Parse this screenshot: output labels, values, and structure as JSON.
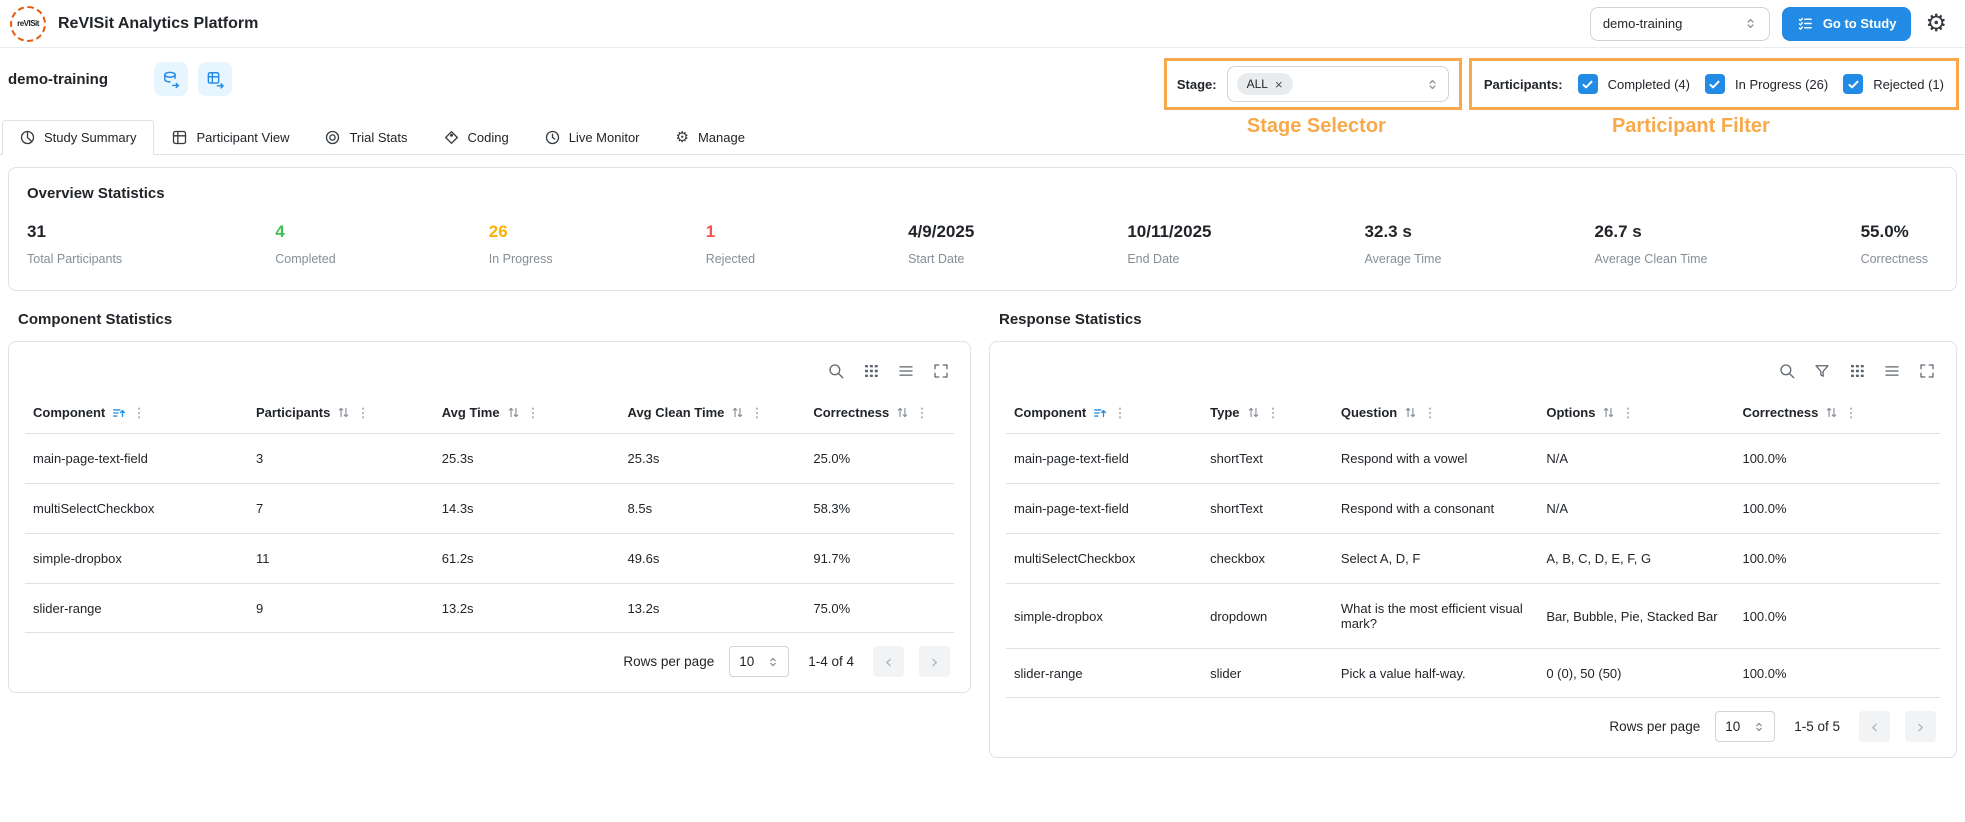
{
  "colors": {
    "accent_blue": "#228be6",
    "completed_green": "#40c057",
    "in_progress_orange": "#fab005",
    "rejected_red": "#fa5252",
    "annotation_orange": "#f7a94b",
    "logo_orange": "#e8590c"
  },
  "icons": {
    "gear": "⚙",
    "close": "×",
    "chevron_left": "‹",
    "chevron_right": "›"
  },
  "header": {
    "logo_text": "reVISit",
    "app_title": "ReVISit Analytics Platform",
    "study_select_value": "demo-training",
    "go_to_study_label": "Go to Study"
  },
  "subheader": {
    "study_name": "demo-training",
    "stage": {
      "label": "Stage:",
      "selected_tag": "ALL"
    },
    "participants": {
      "label": "Participants:",
      "checkboxes": [
        {
          "label": "Completed (4)",
          "checked": true
        },
        {
          "label": "In Progress (26)",
          "checked": true
        },
        {
          "label": "Rejected (1)",
          "checked": true
        }
      ]
    },
    "annotations": {
      "stage": "Stage Selector",
      "participants": "Participant Filter"
    }
  },
  "tabs": [
    {
      "label": "Study Summary",
      "active": true
    },
    {
      "label": "Participant View",
      "active": false
    },
    {
      "label": "Trial Stats",
      "active": false
    },
    {
      "label": "Coding",
      "active": false
    },
    {
      "label": "Live Monitor",
      "active": false
    },
    {
      "label": "Manage",
      "active": false
    }
  ],
  "overview": {
    "title": "Overview Statistics",
    "stats": [
      {
        "value": "31",
        "label": "Total Participants"
      },
      {
        "value": "4",
        "label": "Completed"
      },
      {
        "value": "26",
        "label": "In Progress"
      },
      {
        "value": "1",
        "label": "Rejected"
      },
      {
        "value": "4/9/2025",
        "label": "Start Date"
      },
      {
        "value": "10/11/2025",
        "label": "End Date"
      },
      {
        "value": "32.3 s",
        "label": "Average Time"
      },
      {
        "value": "26.7 s",
        "label": "Average Clean Time"
      },
      {
        "value": "55.0%",
        "label": "Correctness"
      }
    ]
  },
  "component_stats": {
    "title": "Component Statistics",
    "sorted_column": "Component",
    "columns": [
      "Component",
      "Participants",
      "Avg Time",
      "Avg Clean Time",
      "Correctness"
    ],
    "rows": [
      [
        "main-page-text-field",
        "3",
        "25.3s",
        "25.3s",
        "25.0%"
      ],
      [
        "multiSelectCheckbox",
        "7",
        "14.3s",
        "8.5s",
        "58.3%"
      ],
      [
        "simple-dropbox",
        "11",
        "61.2s",
        "49.6s",
        "91.7%"
      ],
      [
        "slider-range",
        "9",
        "13.2s",
        "13.2s",
        "75.0%"
      ]
    ],
    "footer": {
      "rows_per_page_label": "Rows per page",
      "rows_per_page_value": "10",
      "range": "1-4 of 4"
    }
  },
  "response_stats": {
    "title": "Response Statistics",
    "sorted_column": "Component",
    "columns": [
      "Component",
      "Type",
      "Question",
      "Options",
      "Correctness"
    ],
    "rows": [
      [
        "main-page-text-field",
        "shortText",
        "Respond with a vowel",
        "N/A",
        "100.0%"
      ],
      [
        "main-page-text-field",
        "shortText",
        "Respond with a consonant",
        "N/A",
        "100.0%"
      ],
      [
        "multiSelectCheckbox",
        "checkbox",
        "Select A, D, F",
        "A, B, C, D, E, F, G",
        "100.0%"
      ],
      [
        "simple-dropbox",
        "dropdown",
        "What is the most efficient visual mark?",
        "Bar, Bubble, Pie, Stacked Bar",
        "100.0%"
      ],
      [
        "slider-range",
        "slider",
        "Pick a value half-way.",
        "0 (0), 50 (50)",
        "100.0%"
      ]
    ],
    "footer": {
      "rows_per_page_label": "Rows per page",
      "rows_per_page_value": "10",
      "range": "1-5 of 5"
    }
  }
}
